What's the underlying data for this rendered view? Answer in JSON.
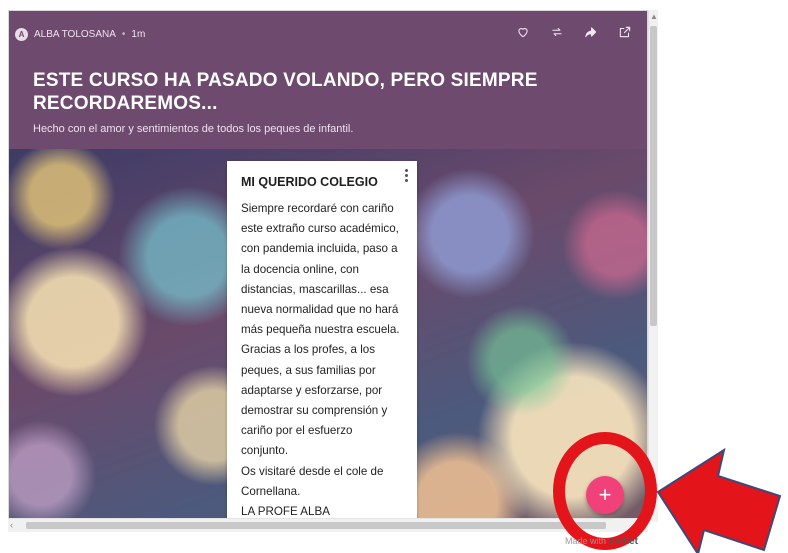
{
  "post": {
    "author_initial": "A",
    "author": "ALBA TOLOSANA",
    "separator": "•",
    "time": "1m",
    "title": "ESTE CURSO HA PASADO VOLANDO, PERO SIEMPRE RECORDAREMOS...",
    "subtitle": "Hecho con el amor y sentimientos de todos los peques de infantil."
  },
  "actions": {
    "like": "heart-icon",
    "repost": "repost-icon",
    "share": "share-arrow-icon",
    "open": "open-external-icon"
  },
  "card": {
    "title": "MI QUERIDO COLEGIO",
    "body": "Siempre recordaré con cariño\neste extraño curso académico,\ncon pandemia incluida, paso a\nla docencia online, con\ndistancias, mascarillas... esa\nnueva normalidad que no hará\nmás pequeña nuestra escuela.\nGracias a los profes, a los\npeques, a sus familias por\nadaptarse y esforzarse, por\ndemostrar su comprensión y\ncariño por el esfuerzo\nconjunto.\nOs visitaré desde el cole de\nCornellana.\nLA PROFE ALBA"
  },
  "fab": {
    "label": "+"
  },
  "footer": {
    "made_with": "Made with",
    "brand": "padlet"
  },
  "colors": {
    "header": "#6e4a6e",
    "fab": "#f0417a",
    "annotation": "#e4141b"
  }
}
